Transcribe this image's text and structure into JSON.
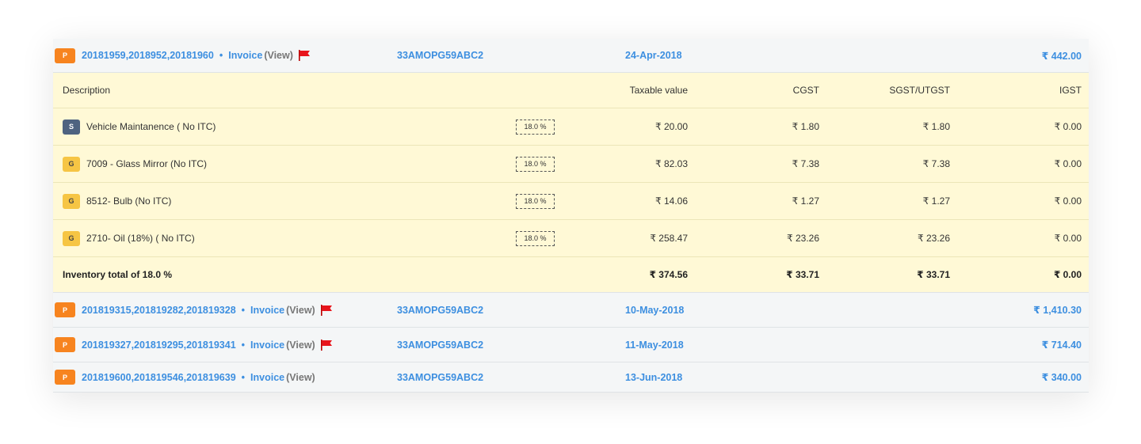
{
  "invoices": [
    {
      "badge": "P",
      "numbers": "20181959,2018952,20181960",
      "sep": "•",
      "type": "Invoice",
      "view": "(View)",
      "flag": true,
      "gstin": "33AMOPG59ABC2",
      "date": "24-Apr-2018",
      "amount": "₹ 442.00",
      "flag_color": "#e8141b"
    },
    {
      "badge": "P",
      "numbers": "201819315,201819282,201819328",
      "sep": "•",
      "type": "Invoice",
      "view": "(View)",
      "flag": true,
      "gstin": "33AMOPG59ABC2",
      "date": "10-May-2018",
      "amount": "₹ 1,410.30",
      "flag_color": "#e8141b"
    },
    {
      "badge": "P",
      "numbers": "201819327,201819295,201819341",
      "sep": "•",
      "type": "Invoice",
      "view": "(View)",
      "flag": true,
      "gstin": "33AMOPG59ABC2",
      "date": "11-May-2018",
      "amount": "₹ 714.40",
      "flag_color": "#e8141b"
    },
    {
      "badge": "P",
      "numbers": "201819600,201819546,201819639",
      "sep": "•",
      "type": "Invoice",
      "view": "(View)",
      "flag": false,
      "gstin": "33AMOPG59ABC2",
      "date": "13-Jun-2018",
      "amount": "₹ 340.00",
      "flag_color": "#e8141b"
    }
  ],
  "items_table": {
    "headers": {
      "description": "Description",
      "taxable": "Taxable value",
      "cgst": "CGST",
      "sgst": "SGST/UTGST",
      "igst": "IGST"
    },
    "rows": [
      {
        "type": "S",
        "description": "Vehicle Maintanence ( No ITC)",
        "rate": "18.0 %",
        "taxable": "₹ 20.00",
        "cgst": "₹ 1.80",
        "sgst": "₹ 1.80",
        "igst": "₹ 0.00"
      },
      {
        "type": "G",
        "description": "7009 - Glass Mirror (No ITC)",
        "rate": "18.0 %",
        "taxable": "₹ 82.03",
        "cgst": "₹ 7.38",
        "sgst": "₹ 7.38",
        "igst": "₹ 0.00"
      },
      {
        "type": "G",
        "description": "8512- Bulb (No ITC)",
        "rate": "18.0 %",
        "taxable": "₹ 14.06",
        "cgst": "₹ 1.27",
        "sgst": "₹ 1.27",
        "igst": "₹ 0.00"
      },
      {
        "type": "G",
        "description": "2710- Oil (18%) ( No ITC)",
        "rate": "18.0 %",
        "taxable": "₹ 258.47",
        "cgst": "₹ 23.26",
        "sgst": "₹ 23.26",
        "igst": "₹ 0.00"
      }
    ],
    "total": {
      "label": "Inventory total of 18.0 %",
      "taxable": "₹ 374.56",
      "cgst": "₹ 33.71",
      "sgst": "₹ 33.71",
      "igst": "₹ 0.00"
    }
  },
  "colors": {
    "link": "#3d8fe0",
    "badge_p": "#f7841f",
    "badge_s": "#4e6380",
    "badge_g": "#f6c544",
    "items_bg": "#fff9d6"
  }
}
